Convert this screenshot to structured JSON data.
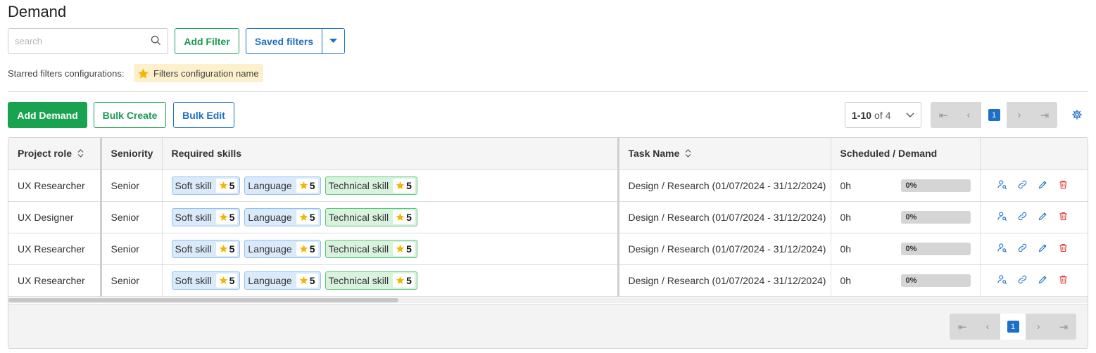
{
  "page": {
    "title": "Demand"
  },
  "search": {
    "placeholder": "search"
  },
  "filters": {
    "add_filter_label": "Add Filter",
    "saved_filters_label": "Saved filters",
    "starred_label": "Starred filters configurations:",
    "starred_chip": "Filters configuration name"
  },
  "toolbar": {
    "add_demand": "Add Demand",
    "bulk_create": "Bulk Create",
    "bulk_edit": "Bulk Edit"
  },
  "pagination": {
    "range": "1-10",
    "of_label": "of",
    "total": "4",
    "current_page": "1"
  },
  "table": {
    "headers": {
      "project_role": "Project role",
      "seniority": "Seniority",
      "required_skills": "Required skills",
      "task_name": "Task Name",
      "scheduled_demand": "Scheduled / Demand"
    },
    "rows": [
      {
        "role": "UX Researcher",
        "seniority": "Senior",
        "skills": [
          {
            "name": "Soft skill",
            "rating": "5"
          },
          {
            "name": "Language",
            "rating": "5"
          },
          {
            "name": "Technical skill",
            "rating": "5"
          }
        ],
        "task": "Design / Research (01/07/2024 - 31/12/2024)",
        "scheduled": "0h",
        "progress": "0%"
      },
      {
        "role": "UX Designer",
        "seniority": "Senior",
        "skills": [
          {
            "name": "Soft skill",
            "rating": "5"
          },
          {
            "name": "Language",
            "rating": "5"
          },
          {
            "name": "Technical skill",
            "rating": "5"
          }
        ],
        "task": "Design / Research (01/07/2024 - 31/12/2024)",
        "scheduled": "0h",
        "progress": "0%"
      },
      {
        "role": "UX Researcher",
        "seniority": "Senior",
        "skills": [
          {
            "name": "Soft skill",
            "rating": "5"
          },
          {
            "name": "Language",
            "rating": "5"
          },
          {
            "name": "Technical skill",
            "rating": "5"
          }
        ],
        "task": "Design / Research (01/07/2024 - 31/12/2024)",
        "scheduled": "0h",
        "progress": "0%"
      },
      {
        "role": "UX Researcher",
        "seniority": "Senior",
        "skills": [
          {
            "name": "Soft skill",
            "rating": "5"
          },
          {
            "name": "Language",
            "rating": "5"
          },
          {
            "name": "Technical skill",
            "rating": "5"
          }
        ],
        "task": "Design / Research (01/07/2024 - 31/12/2024)",
        "scheduled": "0h",
        "progress": "0%"
      }
    ]
  },
  "colors": {
    "primary_blue": "#1e6fc7",
    "primary_green": "#19a351",
    "danger": "#e03a3a",
    "star": "#f5b400"
  },
  "icons": [
    "search-icon",
    "chevron-down-icon",
    "star-icon",
    "sort-icon",
    "first-page-icon",
    "prev-page-icon",
    "next-page-icon",
    "last-page-icon",
    "gear-icon",
    "assign-user-icon",
    "link-icon",
    "pencil-icon",
    "trash-icon"
  ]
}
